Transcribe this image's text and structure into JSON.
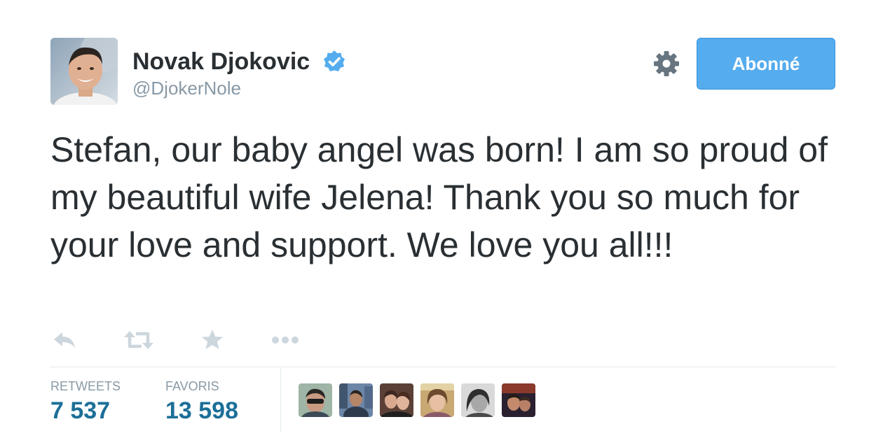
{
  "user": {
    "name": "Novak Djokovic",
    "handle": "@DjokerNole",
    "verified": true,
    "avatar": "avatar-photo"
  },
  "actions": {
    "settings_icon": "gear-icon",
    "follow_label": "Abonné"
  },
  "tweet": {
    "text": "Stefan, our baby angel was born! I am so proud of my beautiful wife Jelena! Thank you so much for your love and support. We love you all!!!"
  },
  "tweet_actions": [
    "reply-icon",
    "retweet-icon",
    "favorite-icon",
    "more-icon"
  ],
  "stats": {
    "retweets_label": "RETWEETS",
    "retweets_value": "7 537",
    "favorites_label": "FAVORIS",
    "favorites_value": "13 598"
  },
  "favoriters": [
    "avatar",
    "avatar",
    "avatar",
    "avatar",
    "avatar",
    "avatar"
  ],
  "colors": {
    "accent": "#55acee",
    "stat_value": "#1c6f98",
    "muted": "#8899a6",
    "text": "#292f33",
    "icon": "#ccd6dd"
  }
}
